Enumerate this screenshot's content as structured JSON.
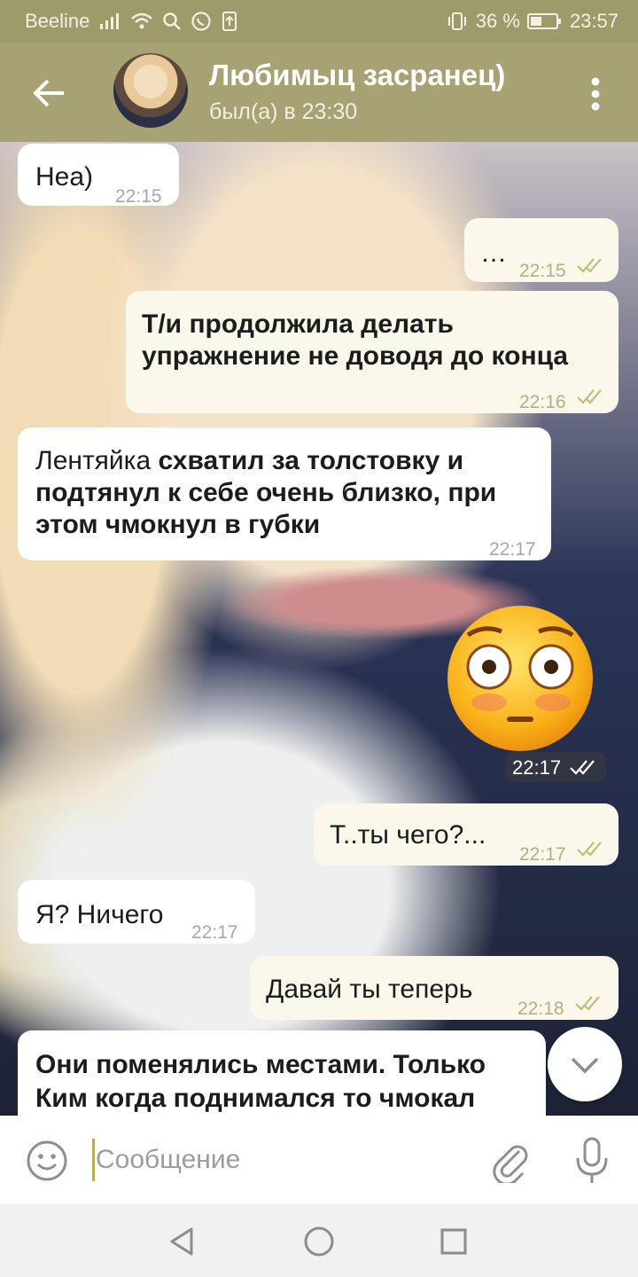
{
  "status_bar": {
    "carrier": "Beeline",
    "battery": "36 %",
    "time": "23:57",
    "icons": [
      "signal-icon",
      "wifi-icon",
      "search-icon",
      "whatsapp-icon",
      "upload-icon",
      "vibrate-icon",
      "battery-icon"
    ]
  },
  "header": {
    "title": "Любимыц засранец)",
    "subtitle": "был(а) в 23:30",
    "icons": [
      "back-arrow-icon",
      "more-vert-icon"
    ]
  },
  "messages": [
    {
      "dir": "in",
      "text": "Неа)",
      "time": "22:15"
    },
    {
      "dir": "out",
      "text": "…",
      "time": "22:15",
      "read": true
    },
    {
      "dir": "out",
      "text": "Т/и продолжила делать упражнение не доводя до конца",
      "time": "22:16",
      "read": true
    },
    {
      "dir": "in",
      "text_plain": "Лентяйка",
      "text_bold": "схватил за толстовку и подтянул к себе очень близко, при этом чмокнул в губки",
      "time": "22:17"
    },
    {
      "dir": "out",
      "type": "sticker",
      "sticker": "flushed-face-emoji",
      "time": "22:17",
      "read": true
    },
    {
      "dir": "out",
      "text": "Т..ты чего?...",
      "time": "22:17",
      "read": true
    },
    {
      "dir": "in",
      "text": "Я? Ничего",
      "time": "22:17"
    },
    {
      "dir": "out",
      "text": "Давай ты теперь",
      "time": "22:18",
      "read": true
    },
    {
      "dir": "in",
      "text": "Они поменялись местами. Только Ким когда поднимался то чмокал"
    }
  ],
  "input": {
    "placeholder": "Сообщение",
    "icons": [
      "emoji-icon",
      "attach-icon",
      "mic-icon"
    ]
  },
  "scroll_down": {
    "icon": "chevron-down-icon"
  },
  "nav_bar": {
    "icons": [
      "back-triangle-icon",
      "home-circle-icon",
      "recents-square-icon"
    ]
  },
  "colors": {
    "header": "#a6a274",
    "status_bar": "#9d9a6b",
    "incoming_bubble": "#ffffff",
    "outgoing_bubble": "#fbf8eb",
    "read_check": "#c3bb7a"
  }
}
